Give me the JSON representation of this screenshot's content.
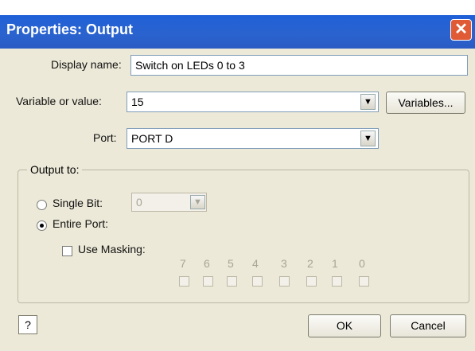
{
  "window": {
    "title": "Properties: Output",
    "close_glyph": "✕"
  },
  "fields": {
    "display_name": {
      "label": "Display name:",
      "value": "Switch on LEDs 0 to 3"
    },
    "variable": {
      "label": "Variable or value:",
      "value": "15",
      "button": "Variables..."
    },
    "port": {
      "label": "Port:",
      "value": "PORT D"
    }
  },
  "output": {
    "group_label": "Output to:",
    "single_bit": {
      "label": "Single Bit:",
      "value": "0",
      "selected": false
    },
    "entire_port": {
      "label": "Entire Port:",
      "selected": true
    },
    "use_masking": {
      "label": "Use Masking:",
      "checked": false
    },
    "bits": [
      "7",
      "6",
      "5",
      "4",
      "3",
      "2",
      "1",
      "0"
    ]
  },
  "footer": {
    "help": "?",
    "ok": "OK",
    "cancel": "Cancel"
  }
}
